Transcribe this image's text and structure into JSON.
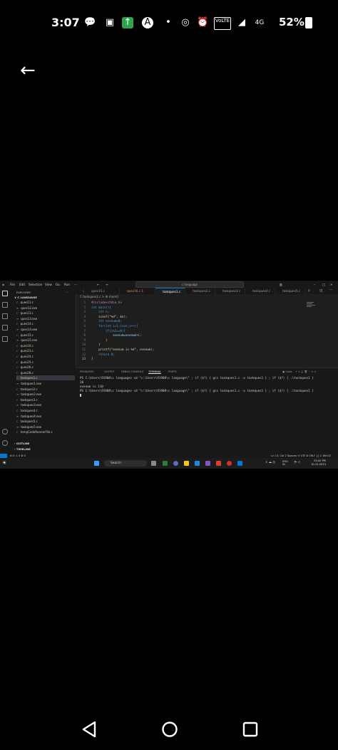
{
  "phone": {
    "time": "3:07",
    "network": "4G",
    "volte": "VoLTE",
    "battery": "52%"
  },
  "window": {
    "menu": [
      "File",
      "Edit",
      "Selection",
      "View",
      "Go",
      "Run"
    ],
    "search": "c language"
  },
  "explorer": {
    "header": "EXPLORER",
    "folder": "C LANGUAGE",
    "files": [
      "ques11.c",
      "ques12.exe",
      "ques13.c",
      "ques13.exe",
      "ques14.c",
      "ques14.exe",
      "ques15.c",
      "ques15.exe",
      "ques16.c",
      "ques21.c",
      "ques24.c",
      "ques25.c",
      "ques26.c",
      "ques28.c",
      "taskques1.c",
      "taskques1.exe",
      "taskques2.c",
      "taskques2.exe",
      "taskques3.c",
      "taskques3.exe",
      "taskques4.c",
      "taskques4.exe",
      "taskques5.c",
      "taskques5.exe",
      "tempCodeRunnerFile.c"
    ],
    "outline": "OUTLINE",
    "timeline": "TIMELINE"
  },
  "tabs": [
    {
      "label": "ques15.c"
    },
    {
      "label": "ques16.c 1"
    },
    {
      "label": "taskques1.c"
    },
    {
      "label": "taskques2.c"
    },
    {
      "label": "taskques3.c"
    },
    {
      "label": "taskques4.c"
    },
    {
      "label": "taskques5.c"
    }
  ],
  "breadcrumb": "C taskques1.c > ⚙ main()",
  "code": [
    {
      "n": "1",
      "t": "#include<stdio.h>"
    },
    {
      "n": "2",
      "t": "int main(){"
    },
    {
      "n": "3",
      "t": "    int n;"
    },
    {
      "n": "4",
      "t": "    scanf(\"%d\", &n);"
    },
    {
      "n": "5",
      "t": "    int evenum=0;"
    },
    {
      "n": "6",
      "t": "    for(int i=1;i<=n;i++){"
    },
    {
      "n": "7",
      "t": "        if(i%2==0){"
    },
    {
      "n": "8",
      "t": "            evenum=evenum+i;"
    },
    {
      "n": "9",
      "t": "        }"
    },
    {
      "n": "10",
      "t": "    }"
    },
    {
      "n": "11",
      "t": "    printf(\"evenum is %d\", evenum);"
    },
    {
      "n": "12",
      "t": "    return 0;"
    },
    {
      "n": "13",
      "t": "}"
    }
  ],
  "panel": {
    "tabs": [
      "PROBLEMS",
      "OUTPUT",
      "DEBUG CONSOLE",
      "TERMINAL",
      "PORTS"
    ],
    "shell": "Code",
    "terminal": [
      "PS C:\\Users\\91900\\c language> cd \"c:\\Users\\91900\\c language\\\" ; if ($?) { gcc taskques1.c -o taskques1 } ; if ($?) { .\\taskques1 }",
      "20",
      "evenum is 110",
      "PS C:\\Users\\91900\\c language> cd \"c:\\Users\\91900\\c language\\\" ; if ($?) { gcc taskques1.c -o taskques1 } ; if ($?) { .\\taskques1 }"
    ]
  },
  "statusbar": {
    "left": "⊗ 0 ⚠ 0   ⚙ 0",
    "right": "Ln 13, Col 2   Spaces: 4   UTF-8   CRLF   {} C   Win32"
  },
  "taskbar": {
    "search": "Search",
    "lang": "ENG IN",
    "time": "03:42 PM",
    "date": "10-12-2023"
  },
  "colors": {
    "accent": "#0078d4",
    "keyword": "#569cd6",
    "string": "#ce9178",
    "preproc": "#c586c0",
    "function": "#dcdcaa",
    "variable": "#9cdcfe"
  }
}
